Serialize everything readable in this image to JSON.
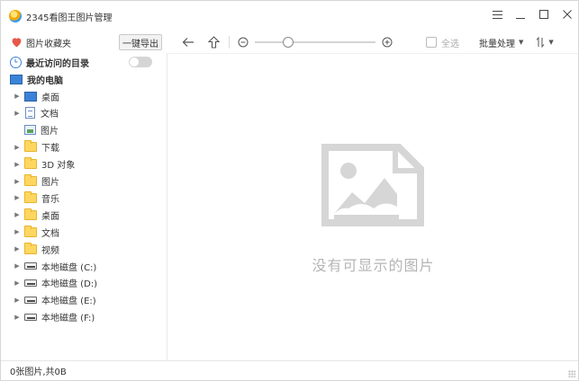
{
  "window": {
    "title": "2345看图王图片管理",
    "controls": [
      "menu-icon",
      "minimize-icon",
      "maximize-icon",
      "close-icon"
    ]
  },
  "toolbar": {
    "favorites_label": "图片收藏夹",
    "export_label": "一键导出",
    "zoom_level": 0.25,
    "select_all_label": "全选",
    "batch_label": "批量处理",
    "sort_icon": "sort-icon",
    "colors": {
      "heart": "#e8584a"
    }
  },
  "sidebar": {
    "recent": {
      "label": "最近访问的目录",
      "toggle_on": false
    },
    "computer": {
      "label": "我的电脑"
    },
    "items": [
      {
        "label": "桌面",
        "icon": "desktop-icon",
        "expandable": true
      },
      {
        "label": "文档",
        "icon": "document-icon",
        "expandable": true
      },
      {
        "label": "图片",
        "icon": "picture-icon",
        "expandable": false
      },
      {
        "label": "下载",
        "icon": "folder-icon",
        "expandable": true
      },
      {
        "label": "3D 对象",
        "icon": "folder-icon",
        "expandable": true
      },
      {
        "label": "图片",
        "icon": "folder-icon",
        "expandable": true
      },
      {
        "label": "音乐",
        "icon": "folder-icon",
        "expandable": true
      },
      {
        "label": "桌面",
        "icon": "folder-icon",
        "expandable": true
      },
      {
        "label": "文档",
        "icon": "folder-icon",
        "expandable": true
      },
      {
        "label": "视频",
        "icon": "folder-icon",
        "expandable": true
      },
      {
        "label": "本地磁盘 (C:)",
        "icon": "drive-icon",
        "expandable": true
      },
      {
        "label": "本地磁盘 (D:)",
        "icon": "drive-icon",
        "expandable": true
      },
      {
        "label": "本地磁盘 (E:)",
        "icon": "drive-icon",
        "expandable": true
      },
      {
        "label": "本地磁盘 (F:)",
        "icon": "drive-icon",
        "expandable": true
      }
    ]
  },
  "main": {
    "empty_text": "没有可显示的图片",
    "placeholder_icon": "image-placeholder-icon"
  },
  "status": {
    "text": "0张图片,共0B"
  }
}
